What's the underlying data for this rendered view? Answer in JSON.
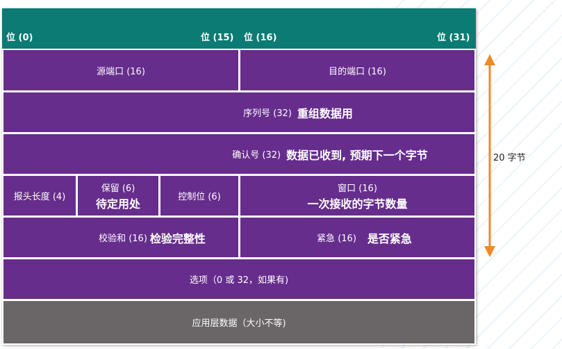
{
  "header": {
    "bit0": "位 (0)",
    "bit15": "位 (15)",
    "bit16": "位 (16)",
    "bit31": "位 (31)"
  },
  "fields": {
    "source_port": "源端口 (16)",
    "dest_port": "目的端口 (16)",
    "sequence": "序列号 (32)",
    "sequence_note": "重组数据用",
    "ack": "确认号 (32)",
    "ack_note": "数据已收到, 预期下一个字节",
    "header_length": "报头长度 (4)",
    "reserved": "保留 (6)",
    "reserved_note": "待定用处",
    "control": "控制位 (6)",
    "window": "窗口 (16)",
    "window_note": "一次接收的字节数量",
    "checksum": "校验和 (16)",
    "checksum_note": "检验完整性",
    "urgent": "紧急 (16)",
    "urgent_note": "是否紧急",
    "options": "选项（0 或 32，如果有)",
    "app_data": "应用层数据（大小不等)"
  },
  "side": {
    "label": "20 字节"
  },
  "colors": {
    "header": "#0b7b73",
    "field": "#662d8c",
    "data": "#6a6566",
    "arrow": "#f0892a"
  }
}
